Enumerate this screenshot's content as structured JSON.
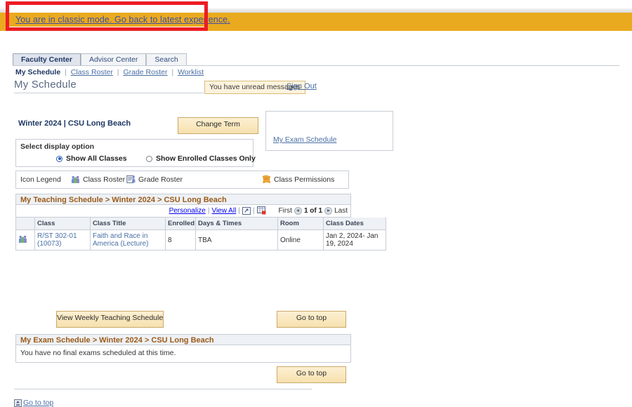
{
  "banner": {
    "classic_mode_link": "You are in classic mode. Go back to latest experience.",
    "band_color": "#eaaa20",
    "annotation_box_color": "#ed1c24"
  },
  "tabs": [
    {
      "label": "Faculty Center",
      "active": true
    },
    {
      "label": "Advisor Center",
      "active": false
    },
    {
      "label": "Search",
      "active": false
    }
  ],
  "subnav": {
    "current": "My Schedule",
    "links": [
      "Class Roster",
      "Grade Roster",
      "Worklist"
    ],
    "separator": "|"
  },
  "header": {
    "page_title": "My Schedule",
    "unread_messages": "You have unread messages",
    "sign_out": "Sign Out"
  },
  "term": {
    "label": "Winter 2024 | CSU Long Beach",
    "change_term_button": "Change Term"
  },
  "exam_panel": {
    "link": "My Exam Schedule"
  },
  "display_option": {
    "legend": "Select display option",
    "options": [
      {
        "label": "Show All Classes",
        "selected": true
      },
      {
        "label": "Show Enrolled Classes Only",
        "selected": false
      }
    ]
  },
  "icon_legend": {
    "title": "Icon Legend",
    "items": [
      {
        "icon": "class-roster-icon",
        "label": "Class Roster"
      },
      {
        "icon": "grade-roster-icon",
        "label": "Grade Roster"
      },
      {
        "icon": "class-permissions-icon",
        "label": "Class Permissions"
      }
    ]
  },
  "teaching_schedule": {
    "group_title": "My Teaching Schedule > Winter 2024 > CSU Long Beach",
    "toolbar": {
      "personalize": "Personalize",
      "view_all": "View All",
      "sep": "|",
      "expand_icon": "expand-grid-icon",
      "download_icon": "download-spreadsheet-icon",
      "first": "First",
      "page_indicator": "1 of 1",
      "last": "Last",
      "prev_icon": "prev-arrow-icon",
      "next_icon": "next-arrow-icon"
    },
    "columns": [
      "",
      "Class",
      "Class Title",
      "Enrolled",
      "Days & Times",
      "Room",
      "Class Dates"
    ],
    "rows": [
      {
        "icon": "class-roster-icon",
        "class": "R/ST 302-01 (10073)",
        "class_title": "Faith and Race in America (Lecture)",
        "enrolled": "8",
        "days_times": "TBA",
        "room": "Online",
        "class_dates": "Jan 2, 2024- Jan 19, 2024"
      }
    ]
  },
  "buttons": {
    "view_weekly_teaching_schedule": "View Weekly Teaching Schedule",
    "go_to_top_1": "Go to top",
    "go_to_top_2": "Go to top"
  },
  "exam_schedule": {
    "group_title": "My Exam Schedule > Winter 2024 > CSU Long Beach",
    "message": "You have no final exams scheduled at this time."
  },
  "footer": {
    "go_to_top": "Go to top",
    "go_to_top_icon": "go-to-top-icon"
  }
}
